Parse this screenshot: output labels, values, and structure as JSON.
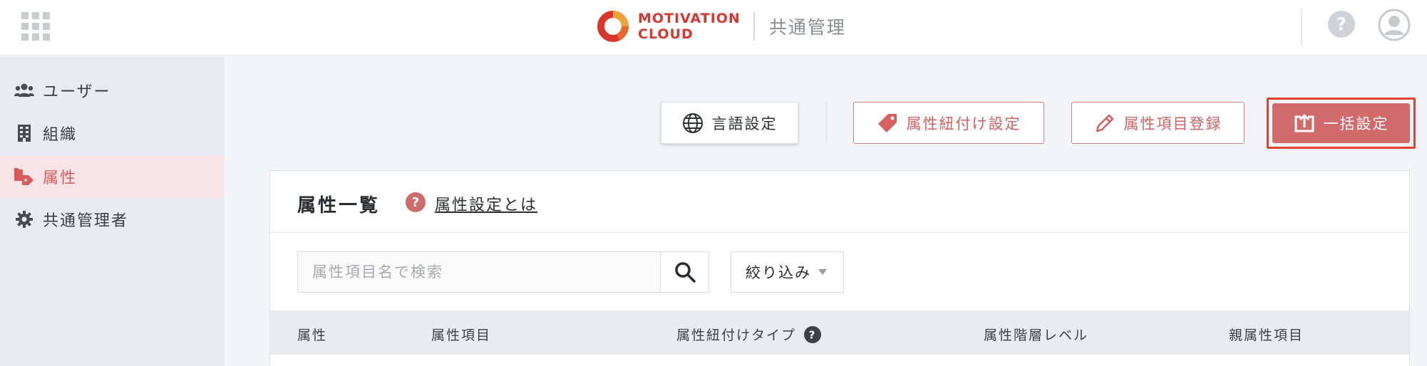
{
  "header": {
    "logo_line1": "MOTIVATION",
    "logo_line2": "CLOUD",
    "app_name": "共通管理",
    "icons": [
      "apps-grid-icon",
      "help-icon",
      "user-avatar-icon"
    ]
  },
  "sidebar": {
    "items": [
      {
        "label": "ユーザー",
        "icon": "users-icon",
        "active": false
      },
      {
        "label": "組織",
        "icon": "building-icon",
        "active": false
      },
      {
        "label": "属性",
        "icon": "tags-icon",
        "active": true
      },
      {
        "label": "共通管理者",
        "icon": "gear-icon",
        "active": false
      }
    ]
  },
  "toolbar": {
    "language_settings": "言語設定",
    "attribute_link_settings": "属性紐付け設定",
    "attribute_item_registration": "属性項目登録",
    "bulk_settings": "一括設定"
  },
  "panel": {
    "title": "属性一覧",
    "help_link": "属性設定とは",
    "search_placeholder": "属性項目名で検索",
    "filter_label": "絞り込み",
    "columns": [
      "属性",
      "属性項目",
      "属性紐付けタイプ",
      "属性階層レベル",
      "親属性項目"
    ]
  },
  "colors": {
    "brand_red": "#d8362e",
    "accent": "#d16a6a",
    "highlight_border": "#e0422f",
    "sidebar_bg": "#e9ebf3",
    "active_bg": "#f6e4e6"
  }
}
